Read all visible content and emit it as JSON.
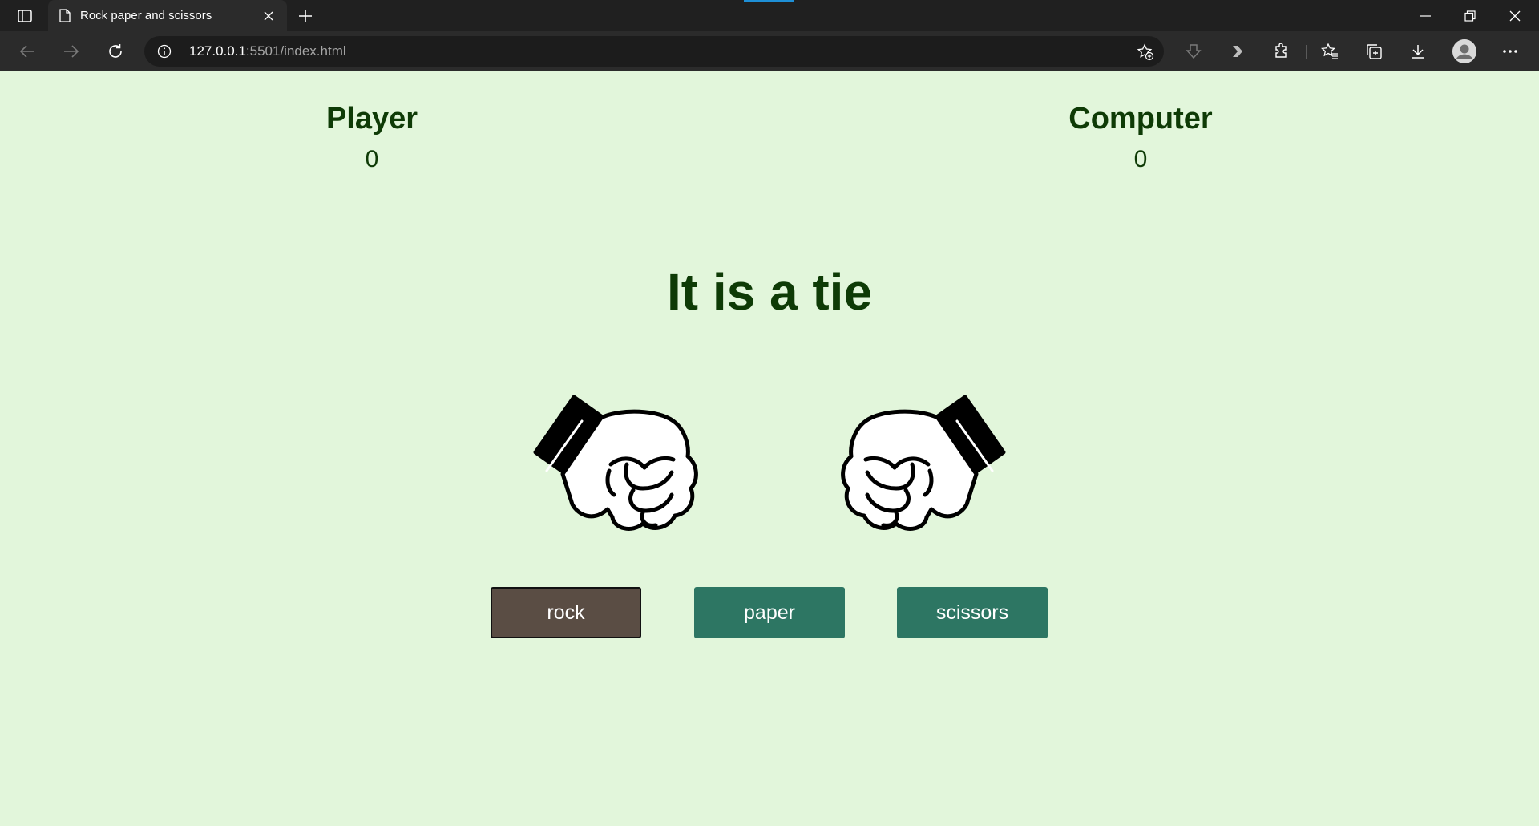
{
  "browser": {
    "tab_title": "Rock paper and scissors",
    "url_host": "127.0.0.1",
    "url_rest": ":5501/index.html"
  },
  "game": {
    "player_label": "Player",
    "player_score": "0",
    "computer_label": "Computer",
    "computer_score": "0",
    "result_text": "It is a tie",
    "player_choice_icon": "rock-fist-icon",
    "computer_choice_icon": "rock-fist-icon",
    "buttons": {
      "rock": "rock",
      "paper": "paper",
      "scissors": "scissors"
    },
    "selected": "rock"
  },
  "colors": {
    "page_bg": "#e2f6db",
    "text": "#0e3b06",
    "button": "#2d7663",
    "button_selected": "#5a4d44"
  }
}
